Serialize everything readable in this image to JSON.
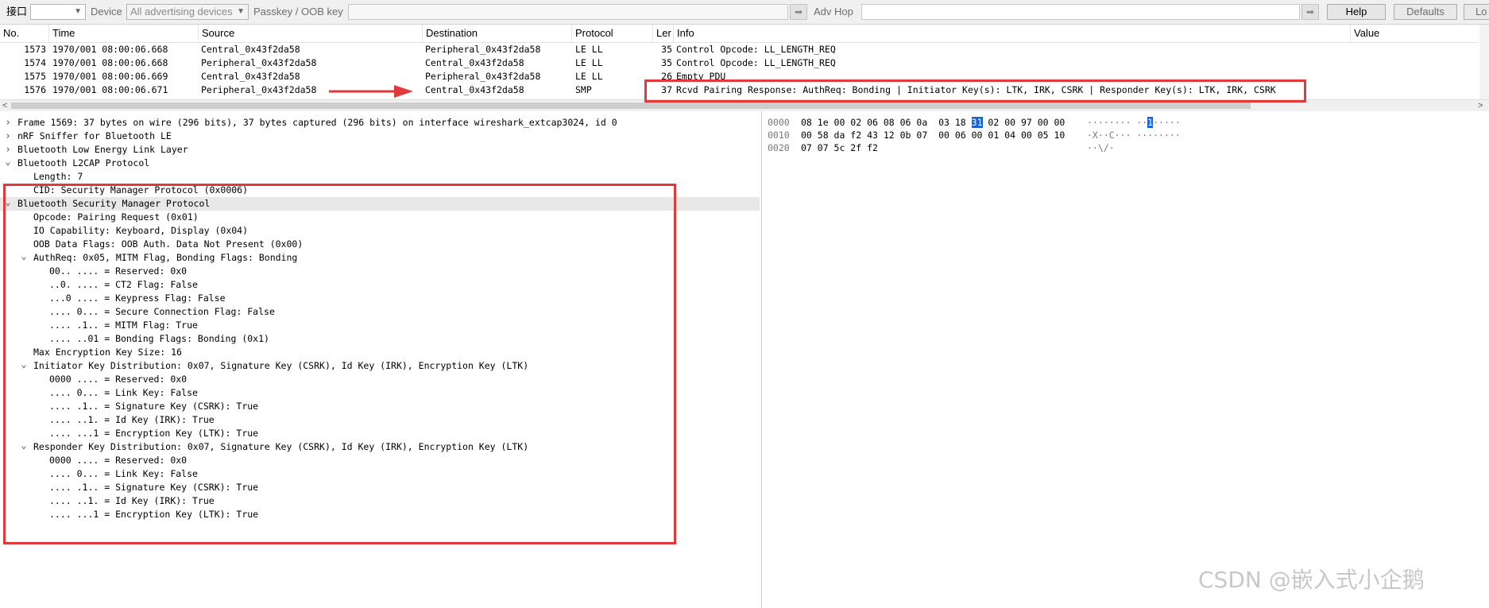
{
  "toolbar": {
    "interface_label": "接口",
    "device_label": "Device",
    "device_value": "All advertising devices",
    "passkey_label": "Passkey / OOB key",
    "adv_hop_label": "Adv Hop",
    "help_label": "Help",
    "defaults_label": "Defaults",
    "log_label": "Lo"
  },
  "packet_list": {
    "columns": {
      "no": "No.",
      "time": "Time",
      "source": "Source",
      "destination": "Destination",
      "protocol": "Protocol",
      "length": "Ler",
      "info": "Info",
      "value": "Value"
    },
    "rows": [
      {
        "no": "1573",
        "time": "1970/001 08:00:06.668",
        "source": "Central_0x43f2da58",
        "destination": "Peripheral_0x43f2da58",
        "protocol": "LE LL",
        "length": "35",
        "info": "Control Opcode: LL_LENGTH_REQ"
      },
      {
        "no": "1574",
        "time": "1970/001 08:00:06.668",
        "source": "Peripheral_0x43f2da58",
        "destination": "Central_0x43f2da58",
        "protocol": "LE LL",
        "length": "35",
        "info": "Control Opcode: LL_LENGTH_REQ"
      },
      {
        "no": "1575",
        "time": "1970/001 08:00:06.669",
        "source": "Central_0x43f2da58",
        "destination": "Peripheral_0x43f2da58",
        "protocol": "LE LL",
        "length": "26",
        "info": "Empty PDU"
      },
      {
        "no": "1576",
        "time": "1970/001 08:00:06.671",
        "source": "Peripheral_0x43f2da58",
        "destination": "Central_0x43f2da58",
        "protocol": "SMP",
        "length": "37",
        "info": "Rcvd Pairing Response: AuthReq: Bonding | Initiator Key(s): LTK, IRK, CSRK | Responder Key(s): LTK, IRK, CSRK"
      }
    ]
  },
  "details": {
    "rows": [
      {
        "level": 0,
        "toggle": "closed",
        "text": "Frame 1569: 37 bytes on wire (296 bits), 37 bytes captured (296 bits) on interface wireshark_extcap3024, id 0"
      },
      {
        "level": 0,
        "toggle": "closed",
        "text": "nRF Sniffer for Bluetooth LE"
      },
      {
        "level": 0,
        "toggle": "closed",
        "text": "Bluetooth Low Energy Link Layer"
      },
      {
        "level": 0,
        "toggle": "open",
        "text": "Bluetooth L2CAP Protocol"
      },
      {
        "level": 1,
        "toggle": "none",
        "text": "Length: 7"
      },
      {
        "level": 1,
        "toggle": "none",
        "text": "CID: Security Manager Protocol (0x0006)"
      },
      {
        "level": 0,
        "toggle": "open",
        "text": "Bluetooth Security Manager Protocol",
        "selected": true
      },
      {
        "level": 1,
        "toggle": "none",
        "text": "Opcode: Pairing Request (0x01)"
      },
      {
        "level": 1,
        "toggle": "none",
        "text": "IO Capability: Keyboard, Display (0x04)"
      },
      {
        "level": 1,
        "toggle": "none",
        "text": "OOB Data Flags: OOB Auth. Data Not Present (0x00)"
      },
      {
        "level": 1,
        "toggle": "open",
        "text": "AuthReq: 0x05, MITM Flag, Bonding Flags: Bonding"
      },
      {
        "level": 2,
        "toggle": "none",
        "text": "00.. .... = Reserved: 0x0"
      },
      {
        "level": 2,
        "toggle": "none",
        "text": "..0. .... = CT2 Flag: False"
      },
      {
        "level": 2,
        "toggle": "none",
        "text": "...0 .... = Keypress Flag: False"
      },
      {
        "level": 2,
        "toggle": "none",
        "text": ".... 0... = Secure Connection Flag: False"
      },
      {
        "level": 2,
        "toggle": "none",
        "text": ".... .1.. = MITM Flag: True"
      },
      {
        "level": 2,
        "toggle": "none",
        "text": ".... ..01 = Bonding Flags: Bonding (0x1)"
      },
      {
        "level": 1,
        "toggle": "none",
        "text": "Max Encryption Key Size: 16"
      },
      {
        "level": 1,
        "toggle": "open",
        "text": "Initiator Key Distribution: 0x07, Signature Key (CSRK), Id Key (IRK), Encryption Key (LTK)"
      },
      {
        "level": 2,
        "toggle": "none",
        "text": "0000 .... = Reserved: 0x0"
      },
      {
        "level": 2,
        "toggle": "none",
        "text": ".... 0... = Link Key: False"
      },
      {
        "level": 2,
        "toggle": "none",
        "text": ".... .1.. = Signature Key (CSRK): True"
      },
      {
        "level": 2,
        "toggle": "none",
        "text": ".... ..1. = Id Key (IRK): True"
      },
      {
        "level": 2,
        "toggle": "none",
        "text": ".... ...1 = Encryption Key (LTK): True"
      },
      {
        "level": 1,
        "toggle": "open",
        "text": "Responder Key Distribution: 0x07, Signature Key (CSRK), Id Key (IRK), Encryption Key (LTK)"
      },
      {
        "level": 2,
        "toggle": "none",
        "text": "0000 .... = Reserved: 0x0"
      },
      {
        "level": 2,
        "toggle": "none",
        "text": ".... 0... = Link Key: False"
      },
      {
        "level": 2,
        "toggle": "none",
        "text": ".... .1.. = Signature Key (CSRK): True"
      },
      {
        "level": 2,
        "toggle": "none",
        "text": ".... ..1. = Id Key (IRK): True"
      },
      {
        "level": 2,
        "toggle": "none",
        "text": ".... ...1 = Encryption Key (LTK): True"
      }
    ]
  },
  "bytes": {
    "rows": [
      {
        "offset": "0000",
        "hex_before": "08 1e 00 02 06 08 06 0a  03 18 ",
        "hex_hl": "31",
        "hex_after": " 02 00 97 00 00",
        "ascii_before": "········ ··",
        "ascii_hl": "1",
        "ascii_after": "·····"
      },
      {
        "offset": "0010",
        "hex_before": "00 58 da f2 43 12 0b 07  00 06 00 01 04 00 05 10",
        "hex_hl": "",
        "hex_after": "",
        "ascii_before": "·X··C··· ········",
        "ascii_hl": "",
        "ascii_after": ""
      },
      {
        "offset": "0020",
        "hex_before": "07 07 5c 2f f2",
        "hex_hl": "",
        "hex_after": "",
        "ascii_before": "··\\/·",
        "ascii_hl": "",
        "ascii_after": ""
      }
    ]
  },
  "icons": {
    "expand": "chevron-down-icon",
    "collapse": "chevron-right-icon",
    "arrow": "arrow-right-icon"
  },
  "colors": {
    "annotation_red": "#e03a3a",
    "byte_highlight": "#1a64d0"
  },
  "watermark": "CSDN @嵌入式小企鹅"
}
